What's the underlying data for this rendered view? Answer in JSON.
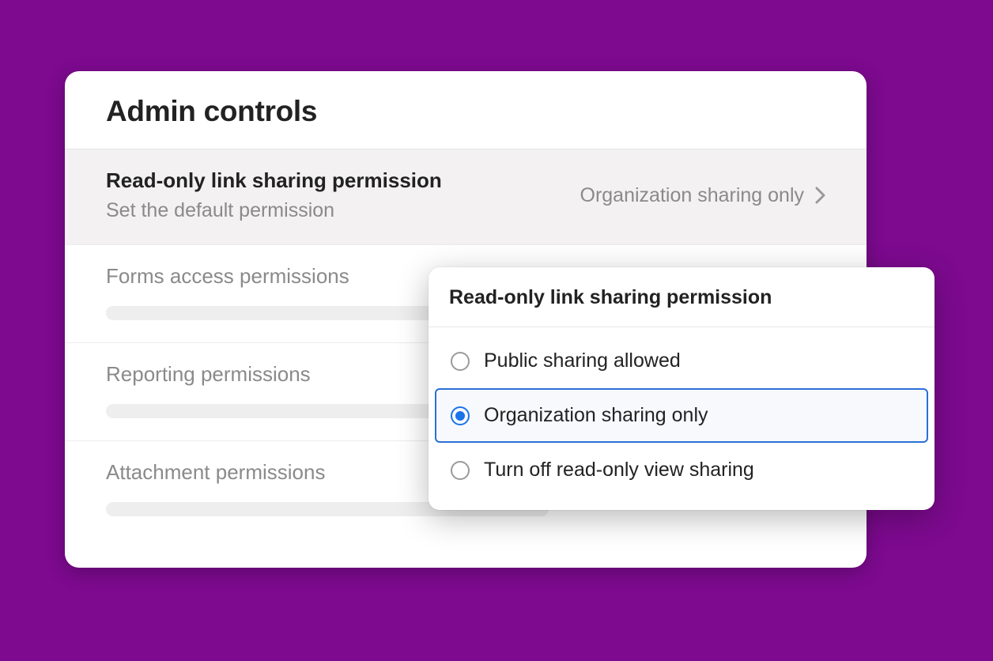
{
  "panel": {
    "title": "Admin controls"
  },
  "rows": {
    "read_only": {
      "title": "Read-only link sharing permission",
      "subtitle": "Set the default permission",
      "value": "Organization sharing only"
    },
    "forms": {
      "title": "Forms access permissions"
    },
    "reporting": {
      "title": "Reporting permissions"
    },
    "attachment": {
      "title": "Attachment permissions"
    }
  },
  "popover": {
    "title": "Read-only link sharing permission",
    "options": [
      {
        "label": "Public sharing allowed",
        "selected": false
      },
      {
        "label": "Organization sharing only",
        "selected": true
      },
      {
        "label": "Turn off read-only view sharing",
        "selected": false
      }
    ]
  }
}
